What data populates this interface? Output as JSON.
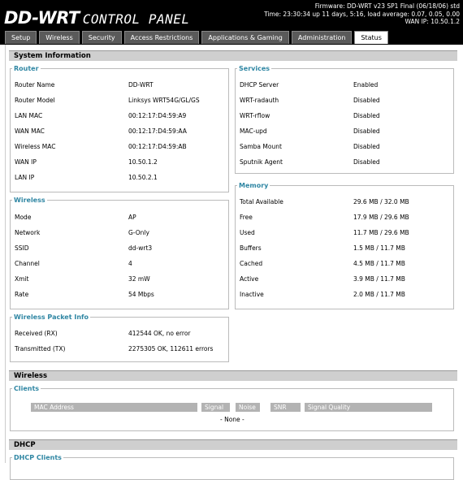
{
  "header": {
    "logo_main": "DD-WRT",
    "logo_sub": "CONTROL PANEL",
    "firmware": "Firmware: DD-WRT v23 SP1 Final (06/18/06) std",
    "time": "Time: 23:30:34 up 11 days, 5:16, load average: 0.07, 0.05, 0.00",
    "wan_ip": "WAN IP: 10.50.1.2"
  },
  "tabs": [
    {
      "label": "Setup"
    },
    {
      "label": "Wireless"
    },
    {
      "label": "Security"
    },
    {
      "label": "Access Restrictions"
    },
    {
      "label": "Applications & Gaming"
    },
    {
      "label": "Administration"
    },
    {
      "label": "Status"
    }
  ],
  "sections": {
    "system_information": "System Information",
    "wireless": "Wireless",
    "dhcp": "DHCP"
  },
  "router": {
    "legend": "Router",
    "rows": [
      {
        "label": "Router Name",
        "value": "DD-WRT"
      },
      {
        "label": "Router Model",
        "value": "Linksys WRT54G/GL/GS"
      },
      {
        "label": "LAN MAC",
        "value": "00:12:17:D4:59:A9"
      },
      {
        "label": "WAN MAC",
        "value": "00:12:17:D4:59:AA"
      },
      {
        "label": "Wireless MAC",
        "value": "00:12:17:D4:59:AB"
      },
      {
        "label": "WAN IP",
        "value": "10.50.1.2"
      },
      {
        "label": "LAN IP",
        "value": "10.50.2.1"
      }
    ]
  },
  "services": {
    "legend": "Services",
    "rows": [
      {
        "label": "DHCP Server",
        "value": "Enabled"
      },
      {
        "label": "WRT-radauth",
        "value": "Disabled"
      },
      {
        "label": "WRT-rflow",
        "value": "Disabled"
      },
      {
        "label": "MAC-upd",
        "value": "Disabled"
      },
      {
        "label": "Samba Mount",
        "value": "Disabled"
      },
      {
        "label": "Sputnik Agent",
        "value": "Disabled"
      }
    ]
  },
  "wireless_info": {
    "legend": "Wireless",
    "rows": [
      {
        "label": "Mode",
        "value": "AP"
      },
      {
        "label": "Network",
        "value": "G-Only"
      },
      {
        "label": "SSID",
        "value": "dd-wrt3"
      },
      {
        "label": "Channel",
        "value": "4"
      },
      {
        "label": "Xmit",
        "value": "32 mW"
      },
      {
        "label": "Rate",
        "value": "54 Mbps"
      }
    ]
  },
  "memory": {
    "legend": "Memory",
    "rows": [
      {
        "label": "Total Available",
        "value": "29.6 MB / 32.0 MB"
      },
      {
        "label": "Free",
        "value": "17.9 MB / 29.6 MB"
      },
      {
        "label": "Used",
        "value": "11.7 MB / 29.6 MB"
      },
      {
        "label": "Buffers",
        "value": "1.5 MB / 11.7 MB"
      },
      {
        "label": "Cached",
        "value": "4.5 MB / 11.7 MB"
      },
      {
        "label": "Active",
        "value": "3.9 MB / 11.7 MB"
      },
      {
        "label": "Inactive",
        "value": "2.0 MB / 11.7 MB"
      }
    ]
  },
  "packet_info": {
    "legend": "Wireless Packet Info",
    "rows": [
      {
        "label": "Received (RX)",
        "value": "412544 OK, no error"
      },
      {
        "label": "Transmitted (TX)",
        "value": "2275305 OK, 112611 errors"
      }
    ]
  },
  "clients": {
    "legend": "Clients",
    "headers": [
      "MAC Address",
      "Signal",
      "Noise",
      "SNR",
      "Signal Quality"
    ],
    "empty": "- None -"
  },
  "dhcp_clients": {
    "legend": "DHCP Clients"
  }
}
